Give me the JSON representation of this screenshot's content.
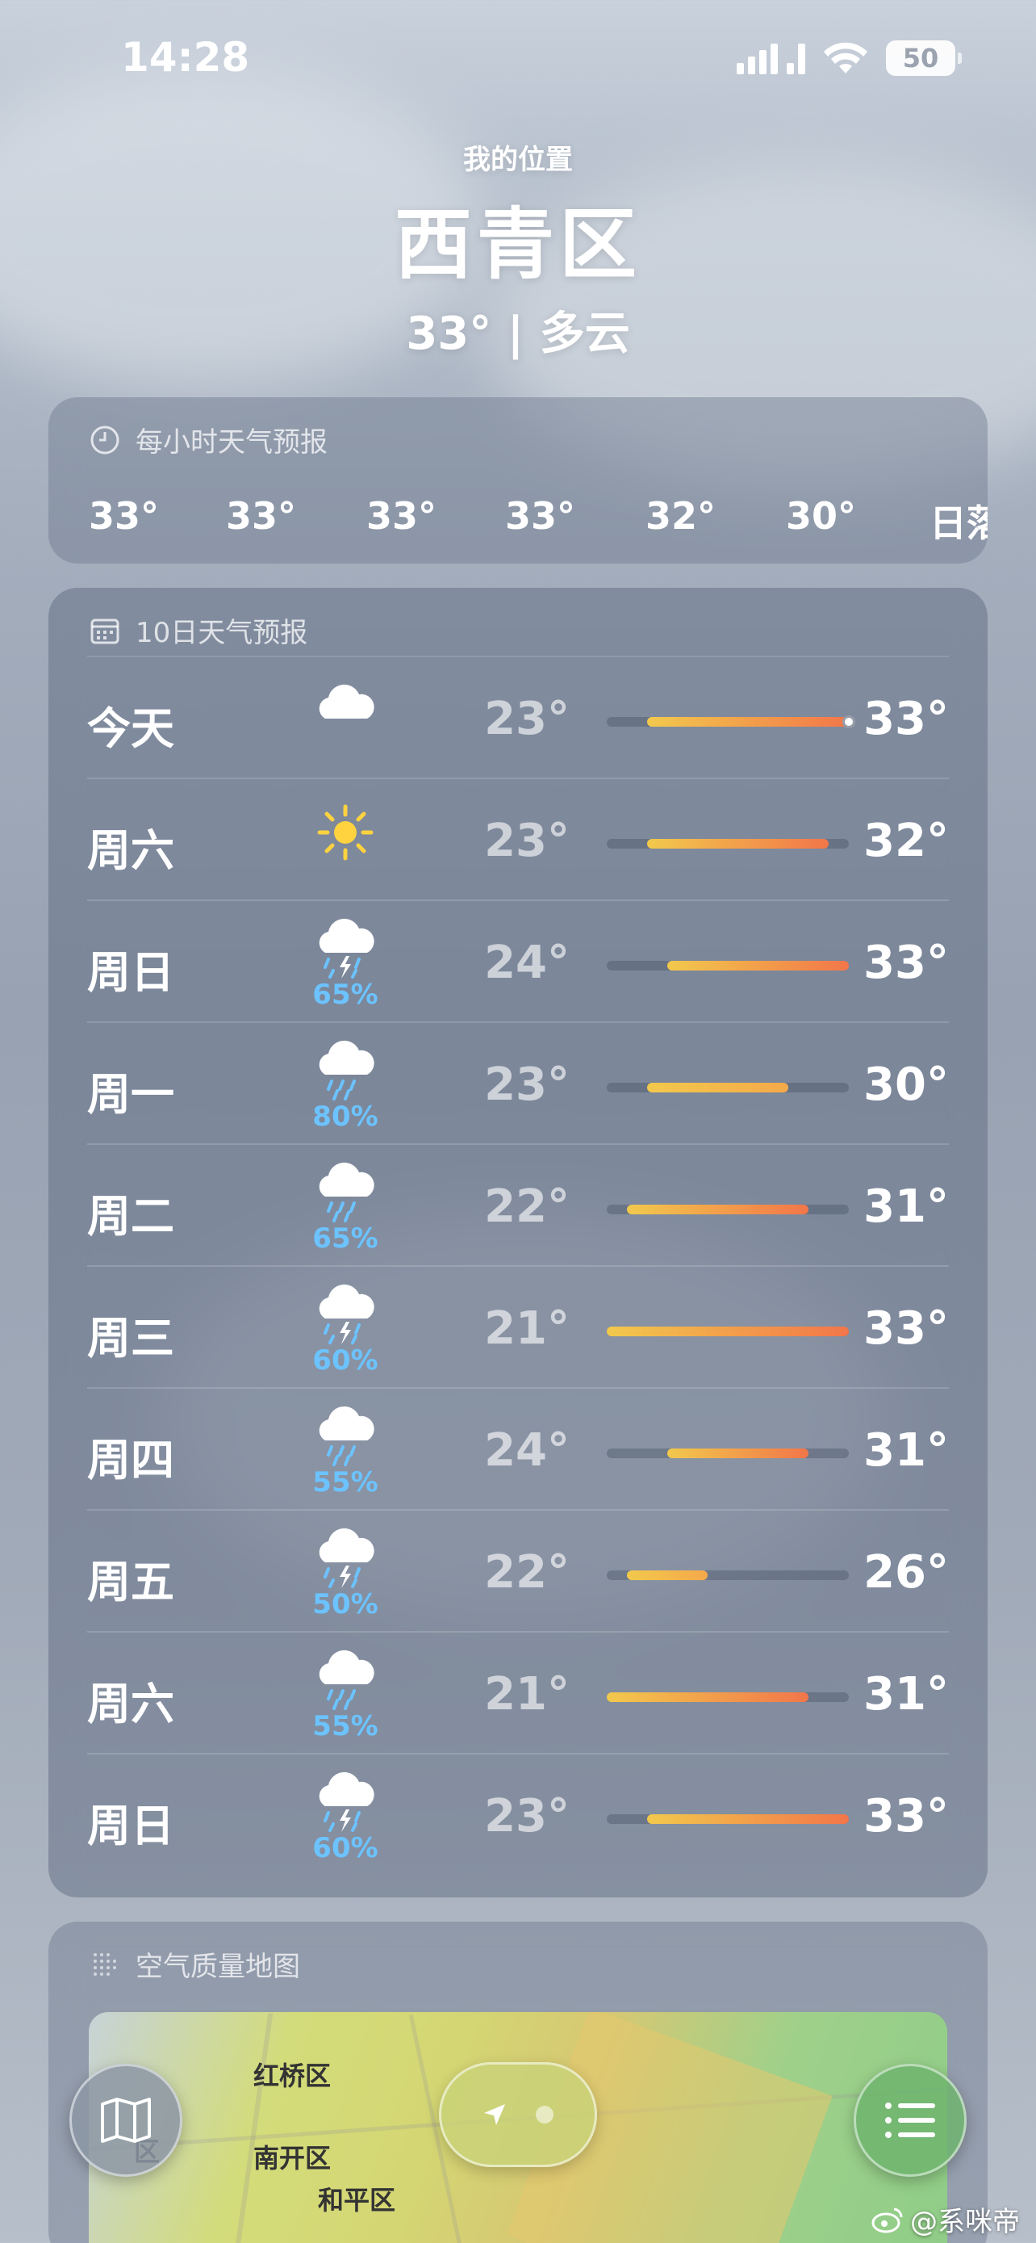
{
  "status_bar": {
    "time": "14:28",
    "battery": "50"
  },
  "header": {
    "location_label": "我的位置",
    "city": "西青区",
    "summary": "33° | 多云"
  },
  "hourly": {
    "title": "每小时天气预报",
    "items": [
      "33°",
      "33°",
      "33°",
      "33°",
      "32°",
      "30°",
      "日落"
    ]
  },
  "daily": {
    "title": "10日天气预报",
    "range": {
      "min": 21,
      "max": 33
    },
    "days": [
      {
        "name": "今天",
        "icon": "cloud",
        "precip": "",
        "low": "23°",
        "high": "33°",
        "bar_from": 23,
        "bar_to": 33,
        "current": 33
      },
      {
        "name": "周六",
        "icon": "sun",
        "precip": "",
        "low": "23°",
        "high": "32°",
        "bar_from": 23,
        "bar_to": 32
      },
      {
        "name": "周日",
        "icon": "thunderstorm",
        "precip": "65%",
        "low": "24°",
        "high": "33°",
        "bar_from": 24,
        "bar_to": 33
      },
      {
        "name": "周一",
        "icon": "rain",
        "precip": "80%",
        "low": "23°",
        "high": "30°",
        "bar_from": 23,
        "bar_to": 30
      },
      {
        "name": "周二",
        "icon": "rain",
        "precip": "65%",
        "low": "22°",
        "high": "31°",
        "bar_from": 22,
        "bar_to": 31
      },
      {
        "name": "周三",
        "icon": "thunderstorm",
        "precip": "60%",
        "low": "21°",
        "high": "33°",
        "bar_from": 21,
        "bar_to": 33
      },
      {
        "name": "周四",
        "icon": "rain",
        "precip": "55%",
        "low": "24°",
        "high": "31°",
        "bar_from": 24,
        "bar_to": 31
      },
      {
        "name": "周五",
        "icon": "thunderstorm",
        "precip": "50%",
        "low": "22°",
        "high": "26°",
        "bar_from": 22,
        "bar_to": 26
      },
      {
        "name": "周六",
        "icon": "rain",
        "precip": "55%",
        "low": "21°",
        "high": "31°",
        "bar_from": 21,
        "bar_to": 31
      },
      {
        "name": "周日",
        "icon": "thunderstorm",
        "precip": "60%",
        "low": "23°",
        "high": "33°",
        "bar_from": 23,
        "bar_to": 33
      }
    ]
  },
  "air_quality": {
    "title": "空气质量地图",
    "map_labels": [
      "红桥区",
      "区",
      "南开区",
      "和平区"
    ]
  },
  "watermark": "@系咪帝",
  "colors": {
    "precip": "#6cc3ff",
    "bar_cool": "#f2c94c",
    "bar_warm": "#f2764a"
  }
}
